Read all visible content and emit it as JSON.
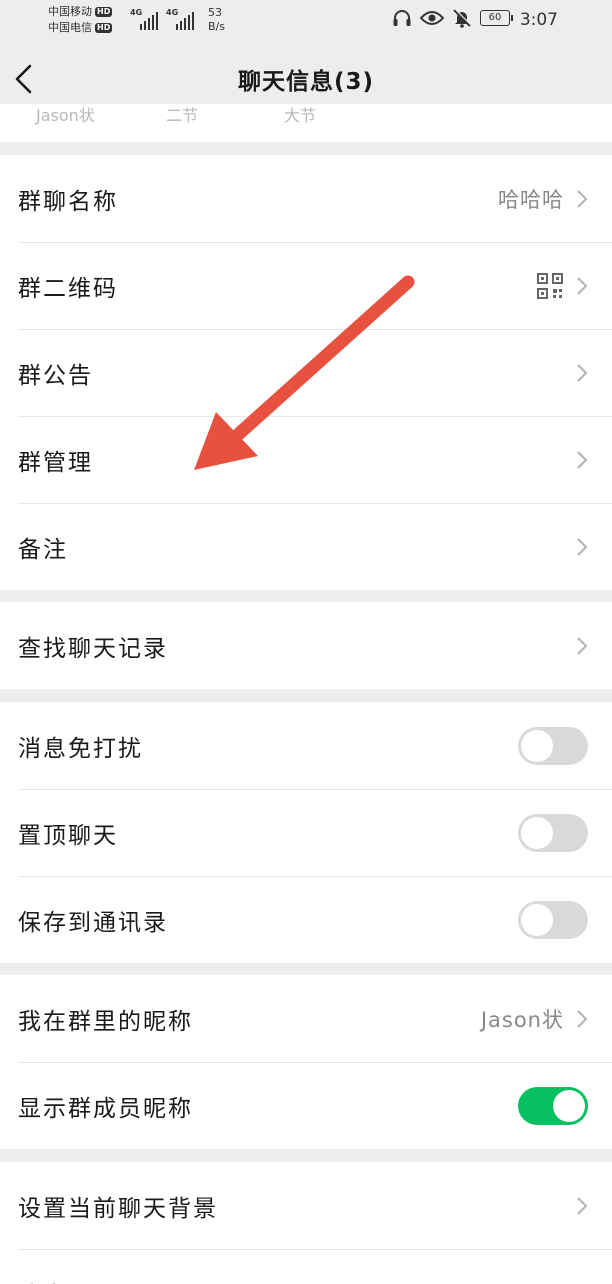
{
  "status_bar": {
    "carrier1": "中国移动",
    "carrier2": "中国电信",
    "hd_badge": "HD",
    "network1": "4G",
    "network2": "4G",
    "speed_value": "53",
    "speed_unit": "B/s",
    "battery": "60",
    "time": "3:07"
  },
  "nav": {
    "title": "聊天信息(3)"
  },
  "members_strip": {
    "partial_names": [
      "Jason状",
      "二节",
      "大节"
    ]
  },
  "groups": {
    "info": [
      {
        "label": "群聊名称",
        "value": "哈哈哈"
      },
      {
        "label": "群二维码"
      },
      {
        "label": "群公告"
      },
      {
        "label": "群管理"
      },
      {
        "label": "备注"
      }
    ],
    "search": [
      {
        "label": "查找聊天记录"
      }
    ],
    "toggles": [
      {
        "label": "消息免打扰",
        "on": false
      },
      {
        "label": "置顶聊天",
        "on": false
      },
      {
        "label": "保存到通讯录",
        "on": false
      }
    ],
    "nickname": [
      {
        "label": "我在群里的昵称",
        "value": "Jason状"
      },
      {
        "label": "显示群成员昵称",
        "on": true
      }
    ],
    "background": [
      {
        "label": "设置当前聊天背景"
      },
      {
        "label": "清空聊天记录"
      }
    ]
  },
  "colors": {
    "accent_green": "#07c160",
    "annotation_red": "#e8513f"
  },
  "icons": {
    "back": "chevron-left-icon",
    "row_arrow": "chevron-right-icon",
    "qr": "qr-code-icon"
  }
}
